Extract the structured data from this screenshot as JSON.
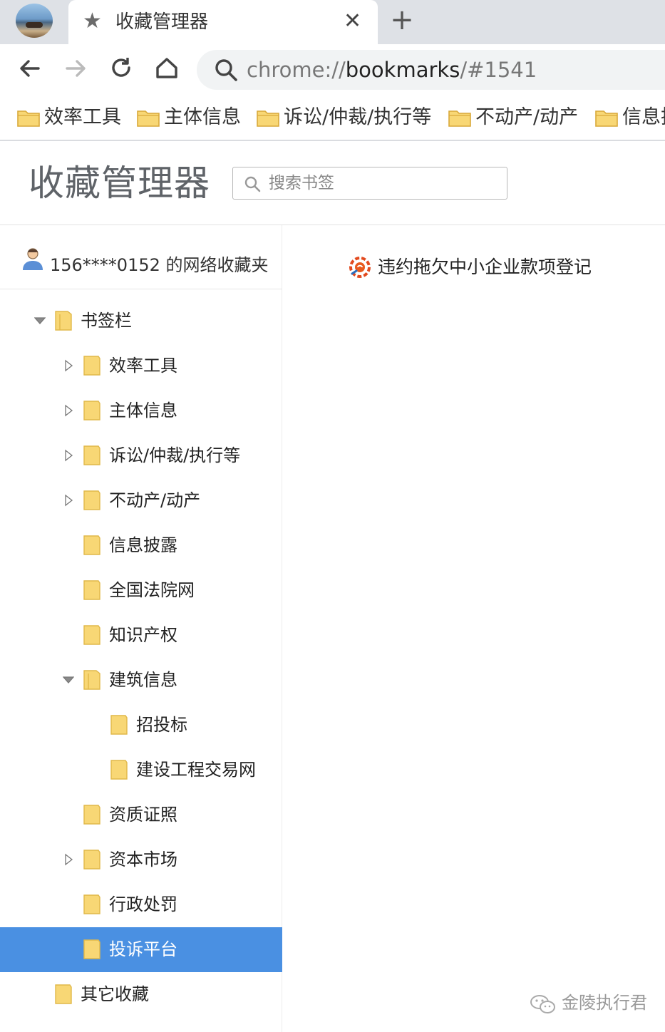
{
  "browser": {
    "tab": {
      "title": "收藏管理器",
      "icon": "star-icon"
    },
    "new_tab_label": "+",
    "close_label": "✕",
    "url": {
      "scheme": "chrome://",
      "host": "bookmarks",
      "path": "/#1541"
    }
  },
  "bookmarks_bar": [
    {
      "label": "效率工具",
      "icon": "folder-icon"
    },
    {
      "label": "主体信息",
      "icon": "folder-icon"
    },
    {
      "label": "诉讼/仲裁/执行等",
      "icon": "folder-icon"
    },
    {
      "label": "不动产/动产",
      "icon": "folder-icon"
    },
    {
      "label": "信息披露",
      "icon": "folder-icon"
    }
  ],
  "manager": {
    "title": "收藏管理器",
    "search_placeholder": "搜索书签"
  },
  "sidebar": {
    "account_label": "156****0152 的网络收藏夹",
    "tree": [
      {
        "label": "书签栏",
        "level": 0,
        "toggle": "expanded"
      },
      {
        "label": "效率工具",
        "level": 1,
        "toggle": "collapsed"
      },
      {
        "label": "主体信息",
        "level": 1,
        "toggle": "collapsed"
      },
      {
        "label": "诉讼/仲裁/执行等",
        "level": 1,
        "toggle": "collapsed"
      },
      {
        "label": "不动产/动产",
        "level": 1,
        "toggle": "collapsed"
      },
      {
        "label": "信息披露",
        "level": 1,
        "toggle": "none"
      },
      {
        "label": "全国法院网",
        "level": 1,
        "toggle": "none"
      },
      {
        "label": "知识产权",
        "level": 1,
        "toggle": "none"
      },
      {
        "label": "建筑信息",
        "level": 1,
        "toggle": "expanded"
      },
      {
        "label": "招投标",
        "level": 2,
        "toggle": "none"
      },
      {
        "label": "建设工程交易网",
        "level": 2,
        "toggle": "none"
      },
      {
        "label": "资质证照",
        "level": 1,
        "toggle": "none"
      },
      {
        "label": "资本市场",
        "level": 1,
        "toggle": "collapsed"
      },
      {
        "label": "行政处罚",
        "level": 1,
        "toggle": "none"
      },
      {
        "label": "投诉平台",
        "level": 1,
        "toggle": "none",
        "selected": true
      },
      {
        "label": "其它收藏",
        "level": 0,
        "toggle": "none"
      }
    ]
  },
  "content": {
    "items": [
      {
        "title": "违约拖欠中小企业款项登记",
        "icon": "site-favicon-icon"
      }
    ]
  },
  "watermark": {
    "text": "金陵执行君",
    "icon": "wechat-icon"
  },
  "colors": {
    "tabstrip": "#dee1e6",
    "selection": "#4a90e2",
    "folder_fill": "#f8d775",
    "folder_stroke": "#d9a93a"
  }
}
